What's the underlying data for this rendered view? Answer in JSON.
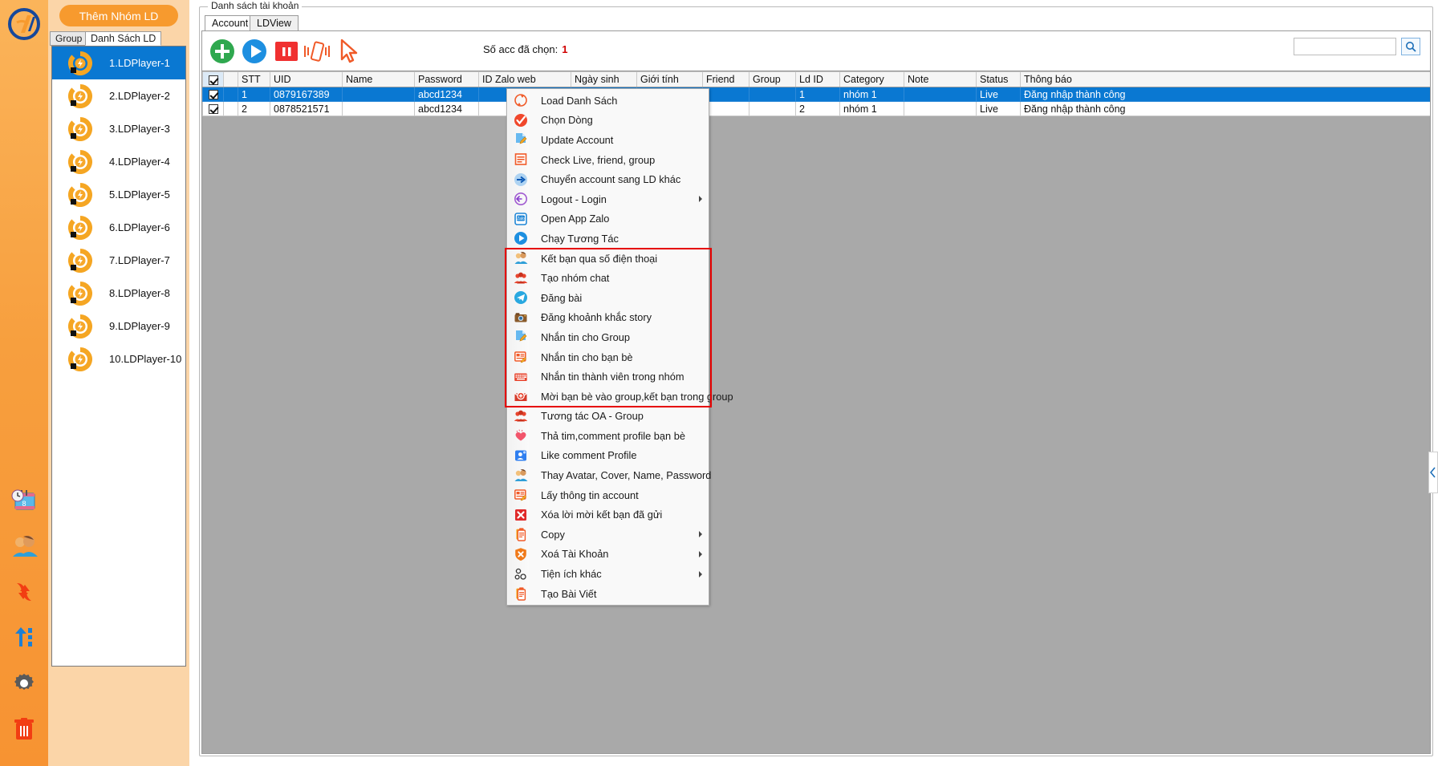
{
  "left_rail": {
    "logo": "app-logo",
    "buttons": [
      {
        "name": "schedule-icon",
        "title": "Lịch"
      },
      {
        "name": "friends-icon",
        "title": "Bạn bè"
      },
      {
        "name": "sync-icon",
        "title": "Đồng bộ"
      },
      {
        "name": "transfer-icon",
        "title": "Chuyển"
      },
      {
        "name": "settings-gear-icon",
        "title": "Cài đặt"
      },
      {
        "name": "trash-icon",
        "title": "Xoá"
      }
    ]
  },
  "left_panel": {
    "add_group_label": "Thêm Nhóm LD",
    "tabs": [
      {
        "label": "Group LD",
        "active": false
      },
      {
        "label": "Danh Sách LD",
        "active": true
      }
    ],
    "ld_items": [
      {
        "label": "1.LDPlayer-1",
        "selected": true
      },
      {
        "label": "2.LDPlayer-2",
        "selected": false
      },
      {
        "label": "3.LDPlayer-3",
        "selected": false
      },
      {
        "label": "4.LDPlayer-4",
        "selected": false
      },
      {
        "label": "5.LDPlayer-5",
        "selected": false
      },
      {
        "label": "6.LDPlayer-6",
        "selected": false
      },
      {
        "label": "7.LDPlayer-7",
        "selected": false
      },
      {
        "label": "8.LDPlayer-8",
        "selected": false
      },
      {
        "label": "9.LDPlayer-9",
        "selected": false
      },
      {
        "label": "10.LDPlayer-10",
        "selected": false
      }
    ]
  },
  "main": {
    "group_title": "Danh sách tài khoản",
    "tabs": [
      {
        "label": "Account",
        "active": true
      },
      {
        "label": "LDView",
        "active": false
      }
    ],
    "toolbar": {
      "add_icon": "add-plus-icon",
      "play_icon": "play-icon",
      "pause_icon": "pause-icon",
      "shake_icon": "shake-phone-icon",
      "cursor_icon": "cursor-pointer-icon",
      "selected_count_label": "Số acc đã chọn:",
      "selected_count_value": "1",
      "search_value": "",
      "search_placeholder": "",
      "search_button_icon": "search-icon"
    },
    "grid": {
      "columns": [
        "STT",
        "UID",
        "Name",
        "Password",
        "ID Zalo web",
        "Ngày sinh",
        "Giới tính",
        "Friend",
        "Group",
        "Ld ID",
        "Category",
        "Note",
        "Status",
        "Thông báo"
      ],
      "rows": [
        {
          "checked": true,
          "selected": true,
          "cells": [
            "1",
            "0879167389",
            "",
            "abcd1234",
            "",
            "",
            "",
            "",
            "",
            "1",
            "nhóm 1",
            "",
            "Live",
            "Đăng nhập thành công"
          ]
        },
        {
          "checked": true,
          "selected": false,
          "cells": [
            "2",
            "0878521571",
            "",
            "abcd1234",
            "",
            "",
            "",
            "",
            "",
            "2",
            "nhóm 1",
            "",
            "Live",
            "Đăng nhập thành công"
          ]
        }
      ]
    }
  },
  "context_menu": {
    "items": [
      {
        "label": "Load Danh Sách",
        "icon": "refresh-icon",
        "submenu": false
      },
      {
        "label": "Chọn Dòng",
        "icon": "check-circle-icon",
        "submenu": false
      },
      {
        "label": "Update Account",
        "icon": "edit-document-icon",
        "submenu": false
      },
      {
        "label": "Check Live, friend, group",
        "icon": "list-report-icon",
        "submenu": false
      },
      {
        "label": "Chuyển account sang LD khác",
        "icon": "arrow-right-circle-icon",
        "submenu": false
      },
      {
        "label": "Logout - Login",
        "icon": "logout-icon",
        "submenu": true
      },
      {
        "label": "Open App Zalo",
        "icon": "zalo-app-icon",
        "submenu": false
      },
      {
        "label": "Chạy Tương Tác",
        "icon": "play-circle-icon",
        "submenu": false
      },
      {
        "label": "Kết bạn qua số điện thoại",
        "icon": "two-people-icon",
        "submenu": false
      },
      {
        "label": "Tạo nhóm chat",
        "icon": "group-people-icon",
        "submenu": false
      },
      {
        "label": "Đăng bài",
        "icon": "send-telegram-icon",
        "submenu": false
      },
      {
        "label": "Đăng khoảnh khắc story",
        "icon": "camera-icon",
        "submenu": false
      },
      {
        "label": "Nhắn tin cho Group",
        "icon": "edit-document-icon",
        "submenu": false
      },
      {
        "label": "Nhắn tin cho bạn bè",
        "icon": "edit-list-icon",
        "submenu": false
      },
      {
        "label": "Nhắn tin thành viên trong nhóm",
        "icon": "keyboard-icon",
        "submenu": false
      },
      {
        "label": "Mời bạn bè vào group,kết bạn trong group",
        "icon": "envelope-add-icon",
        "submenu": false
      },
      {
        "label": "Tương tác OA - Group",
        "icon": "group-people-icon",
        "submenu": false
      },
      {
        "label": "Thả tim,comment profile bạn bè",
        "icon": "heart-icon",
        "submenu": false
      },
      {
        "label": "Like comment Profile",
        "icon": "profile-card-icon",
        "submenu": false
      },
      {
        "label": "Thay Avatar, Cover, Name, Password",
        "icon": "two-people-icon",
        "submenu": false
      },
      {
        "label": "Lấy thông tin account",
        "icon": "edit-list-icon",
        "submenu": false
      },
      {
        "label": "Xóa lời mời kết bạn đã gửi",
        "icon": "red-x-icon",
        "submenu": false
      },
      {
        "label": "Copy",
        "icon": "clipboard-icon",
        "submenu": true
      },
      {
        "label": "Xoá Tài Khoản",
        "icon": "shield-x-icon",
        "submenu": true
      },
      {
        "label": "Tiện ích khác",
        "icon": "gears-icon",
        "submenu": true
      },
      {
        "label": "Tạo Bài Viết",
        "icon": "clipboard-icon",
        "submenu": false
      }
    ],
    "highlight": {
      "start_index": 8,
      "end_index": 15,
      "color": "#e60000"
    }
  },
  "colors": {
    "accent_orange": "#f79a2e",
    "selection_blue": "#0a78d2",
    "highlight_red": "#e60000",
    "panel_bg": "#fbd5a8",
    "grid_bg": "#a9a9a9"
  }
}
